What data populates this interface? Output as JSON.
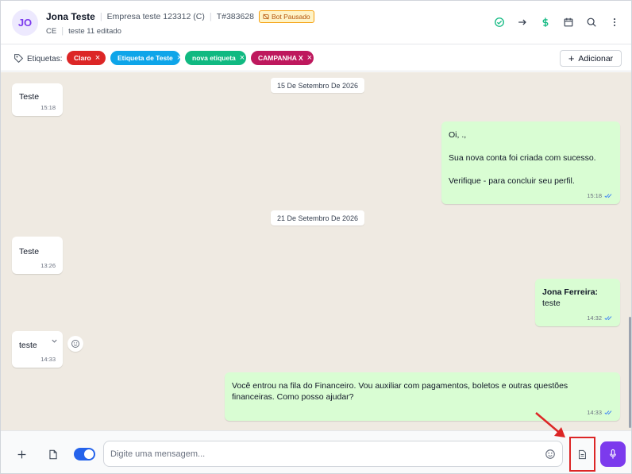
{
  "header": {
    "avatar_initials": "JO",
    "contact_name": "Jona Teste",
    "company": "Empresa teste 123312 (C)",
    "ticket": "T#383628",
    "status_badge": "Bot Pausado",
    "state": "CE",
    "note": "teste 11 editado",
    "actions": [
      "check-circle-icon",
      "arrow-right-icon",
      "dollar-icon",
      "calendar-icon",
      "search-icon",
      "more-vertical-icon"
    ]
  },
  "tags": {
    "label": "Etiquetas:",
    "items": [
      {
        "label": "Claro",
        "color": "#dc2626"
      },
      {
        "label": "Etiqueta de Teste",
        "color": "#0ea5e9"
      },
      {
        "label": "nova etiqueta",
        "color": "#10b981"
      },
      {
        "label": "CAMPANHA X",
        "color": "#be185d"
      }
    ],
    "add_label": "Adicionar"
  },
  "chat": {
    "dates": [
      "15 De Setembro De 2026",
      "21 De Setembro De 2026"
    ],
    "messages": [
      {
        "dir": "in",
        "lines": [
          "Teste"
        ],
        "time": "15:18"
      },
      {
        "dir": "out",
        "lines": [
          "Oi, .,",
          "",
          "Sua nova conta foi criada com sucesso.",
          "",
          "Verifique - para concluir seu perfil."
        ],
        "time": "15:18"
      },
      {
        "dir": "in",
        "lines": [
          "Teste"
        ],
        "time": "13:26"
      },
      {
        "dir": "out",
        "sender": "Jona Ferreira:",
        "lines": [
          "teste"
        ],
        "time": "14:32"
      },
      {
        "dir": "in",
        "lines": [
          "teste"
        ],
        "time": "14:33"
      },
      {
        "dir": "out",
        "lines": [
          "Você entrou na fila do Financeiro. Vou auxiliar com pagamentos, boletos e outras questões",
          "financeiras. Como posso ajudar?"
        ],
        "time": "14:33"
      }
    ]
  },
  "composer": {
    "placeholder": "Digite uma mensagem...",
    "toggle_on": true
  },
  "colors": {
    "accent": "#7c3aed",
    "incoming": "#ffffff",
    "outgoing": "#d9fdd3",
    "chat_bg": "#efeae2",
    "highlight": "#dc2626"
  }
}
